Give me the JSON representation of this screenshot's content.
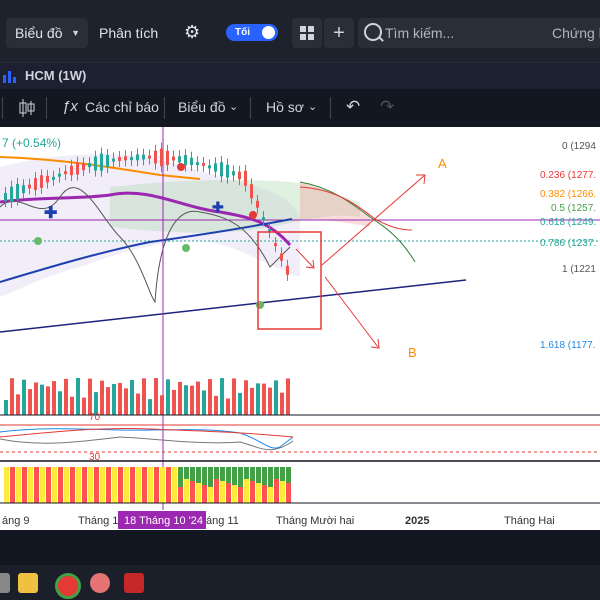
{
  "toolbar": {
    "chart_dropdown": "Biểu đồ",
    "analysis": "Phân tích",
    "theme_toggle": "Tối",
    "search_placeholder": "Tìm kiếm...",
    "stocks_tab": "Chứng k"
  },
  "symbol_bar": {
    "symbol": "HCM (1W)"
  },
  "chart_toolbar": {
    "indicators": "Các chỉ báo",
    "chart_menu": "Biểu đồ",
    "profile_menu": "Hồ sơ"
  },
  "chart": {
    "change_text": "7 (+0.54%)",
    "fib_levels": [
      {
        "label": "0 (1294",
        "color": "#555555"
      },
      {
        "label": "0.236 (1277.",
        "color": "#e53935"
      },
      {
        "label": "0.382 (1266.",
        "color": "#fb8c00"
      },
      {
        "label": "0.5 (1257.",
        "color": "#43a047"
      },
      {
        "label": "0.618 (1249.",
        "color": "#26a69a"
      },
      {
        "label": "0.786 (1237.",
        "color": "#26a69a"
      },
      {
        "label": "1 (1221",
        "color": "#555555"
      },
      {
        "label": "1.618 (1177.",
        "color": "#1e88e5"
      }
    ],
    "annotation_a": "A",
    "annotation_b": "B",
    "rsi_top": "70",
    "rsi_bottom": "30",
    "x_labels": [
      "áng 9",
      "Tháng 1",
      "18 Tháng 10 '24",
      "áng 11",
      "Tháng Mười hai",
      "2025",
      "Tháng Hai"
    ]
  },
  "colors": {
    "up": "#26a69a",
    "down": "#ef5350",
    "accent": "#2962ff",
    "crosshair": "#9c27b0"
  }
}
